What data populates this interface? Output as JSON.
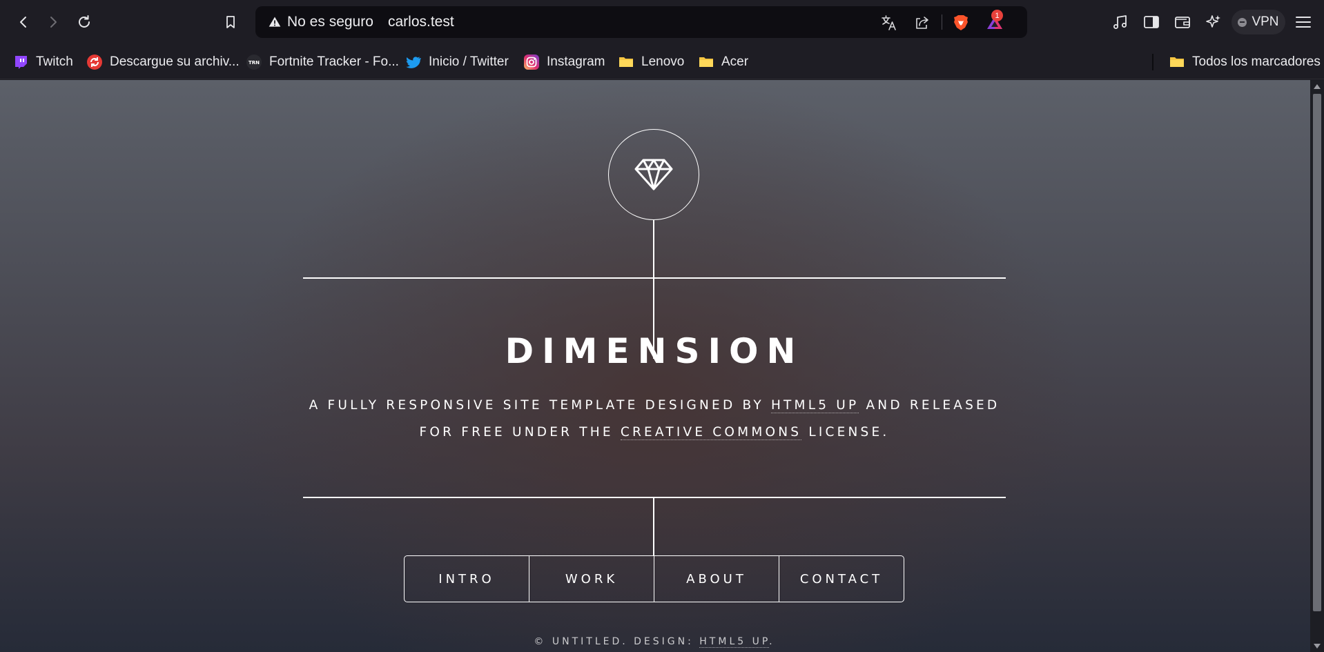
{
  "browser": {
    "security_label": "No es seguro",
    "url": "carlos.test",
    "rewards_count": "1",
    "vpn_label": "VPN",
    "icons": {
      "back": "chevron-left-icon",
      "forward": "chevron-right-icon",
      "reload": "reload-icon",
      "bookmark": "bookmark-icon",
      "translate": "translate-icon",
      "share": "share-icon",
      "brave": "brave-shields-icon",
      "rewards": "brave-rewards-icon",
      "media": "music-note-icon",
      "sidebar": "sidebar-icon",
      "wallet": "wallet-icon",
      "leo": "leo-ai-icon",
      "menu": "hamburger-menu-icon"
    }
  },
  "bookmarks": [
    {
      "label": "Twitch",
      "icon": "twitch-icon"
    },
    {
      "label": "Descargue su archiv...",
      "icon": "download-refresh-icon"
    },
    {
      "label": "Fortnite Tracker - Fo...",
      "icon": "trn-icon"
    },
    {
      "label": "Inicio / Twitter",
      "icon": "twitter-bird-icon"
    },
    {
      "label": "Instagram",
      "icon": "instagram-icon"
    },
    {
      "label": "Lenovo",
      "icon": "folder-icon"
    },
    {
      "label": "Acer",
      "icon": "folder-icon"
    }
  ],
  "bookmarks_all": {
    "label": "Todos los marcadores",
    "icon": "folder-icon"
  },
  "page": {
    "logo_icon": "diamond-icon",
    "title": "DIMENSION",
    "tagline_line1_a": "A FULLY RESPONSIVE SITE TEMPLATE DESIGNED BY ",
    "tagline_link1": "HTML5 UP",
    "tagline_line1_b": " AND RELEASED",
    "tagline_line2_a": "FOR FREE UNDER THE ",
    "tagline_link2": "CREATIVE COMMONS",
    "tagline_line2_b": " LICENSE.",
    "nav": [
      "INTRO",
      "WORK",
      "ABOUT",
      "CONTACT"
    ],
    "footer_prefix": "© UNTITLED. DESIGN: ",
    "footer_link": "HTML5 UP",
    "footer_suffix": "."
  },
  "colors": {
    "chrome_bg": "#1e1d24",
    "urlbar_bg": "#0e0d12",
    "brave_orange": "#fb542b",
    "badge_red": "#e8413b",
    "page_text": "#ffffff"
  }
}
